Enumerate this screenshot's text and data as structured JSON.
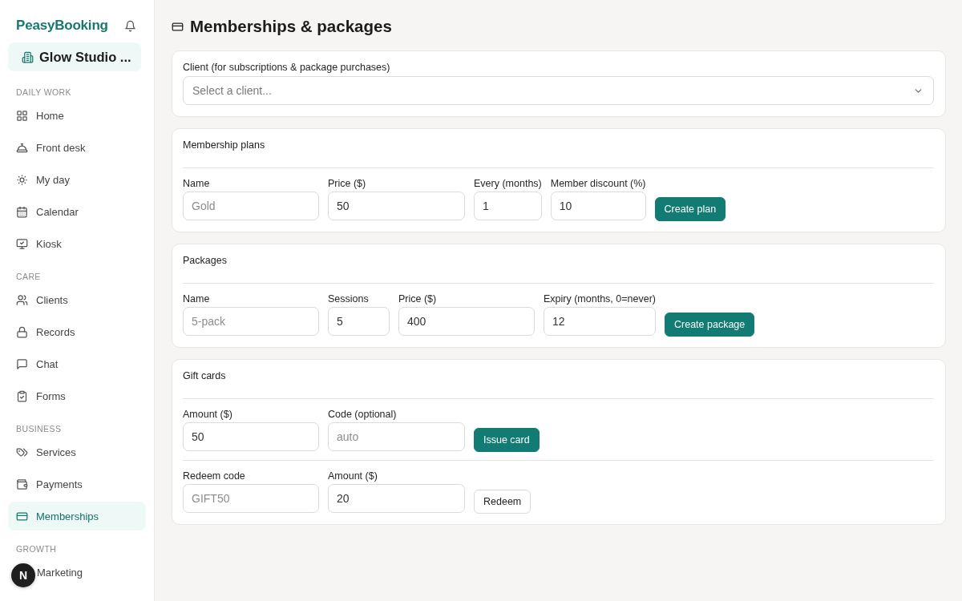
{
  "sidebar": {
    "brand": "PeasyBooking",
    "workspace": "Glow Studio ...",
    "sections": [
      {
        "title": "DAILY WORK",
        "items": [
          {
            "label": "Home",
            "selected": false
          },
          {
            "label": "Front desk",
            "selected": false
          },
          {
            "label": "My day",
            "selected": false
          },
          {
            "label": "Calendar",
            "selected": false
          },
          {
            "label": "Kiosk",
            "selected": false
          }
        ]
      },
      {
        "title": "CARE",
        "items": [
          {
            "label": "Clients",
            "selected": false
          },
          {
            "label": "Records",
            "selected": false
          },
          {
            "label": "Chat",
            "selected": false
          },
          {
            "label": "Forms",
            "selected": false
          }
        ]
      },
      {
        "title": "BUSINESS",
        "items": [
          {
            "label": "Services",
            "selected": false
          },
          {
            "label": "Payments",
            "selected": false
          },
          {
            "label": "Memberships",
            "selected": true
          }
        ]
      },
      {
        "title": "GROWTH",
        "items": [
          {
            "label": "Marketing",
            "selected": false
          }
        ]
      }
    ]
  },
  "dev_badge": {
    "label": "N"
  },
  "page": {
    "title": "Memberships & packages"
  },
  "client_select": {
    "label": "Client (for subscriptions & package purchases)",
    "placeholder": "Select a client..."
  },
  "sections": [
    {
      "title": "Membership plans",
      "rows": [
        {
          "fields": [
            {
              "label": "Name",
              "placeholder": "Gold"
            },
            {
              "label": "Price ($)",
              "value": "50"
            },
            {
              "label": "Every (months)",
              "value": "1"
            },
            {
              "label": "Member discount (%)",
              "value": "10"
            }
          ],
          "button": {
            "label": "Create plan",
            "kind": "primary"
          }
        }
      ]
    },
    {
      "title": "Packages",
      "rows": [
        {
          "fields": [
            {
              "label": "Name",
              "placeholder": "5-pack"
            },
            {
              "label": "Sessions",
              "value": "5"
            },
            {
              "label": "Price ($)",
              "value": "400"
            },
            {
              "label": "Expiry (months, 0=never)",
              "value": "12"
            }
          ],
          "button": {
            "label": "Create package",
            "kind": "primary"
          }
        }
      ]
    },
    {
      "title": "Gift cards",
      "rows": [
        {
          "fields": [
            {
              "label": "Amount ($)",
              "value": "50"
            },
            {
              "label": "Code (optional)",
              "placeholder": "auto"
            }
          ],
          "button": {
            "label": "Issue card",
            "kind": "primary"
          }
        },
        {
          "fields": [
            {
              "label": "Redeem code",
              "placeholder": "GIFT50"
            },
            {
              "label": "Amount ($)",
              "value": "20"
            }
          ],
          "button": {
            "label": "Redeem",
            "kind": "secondary"
          }
        }
      ]
    }
  ]
}
